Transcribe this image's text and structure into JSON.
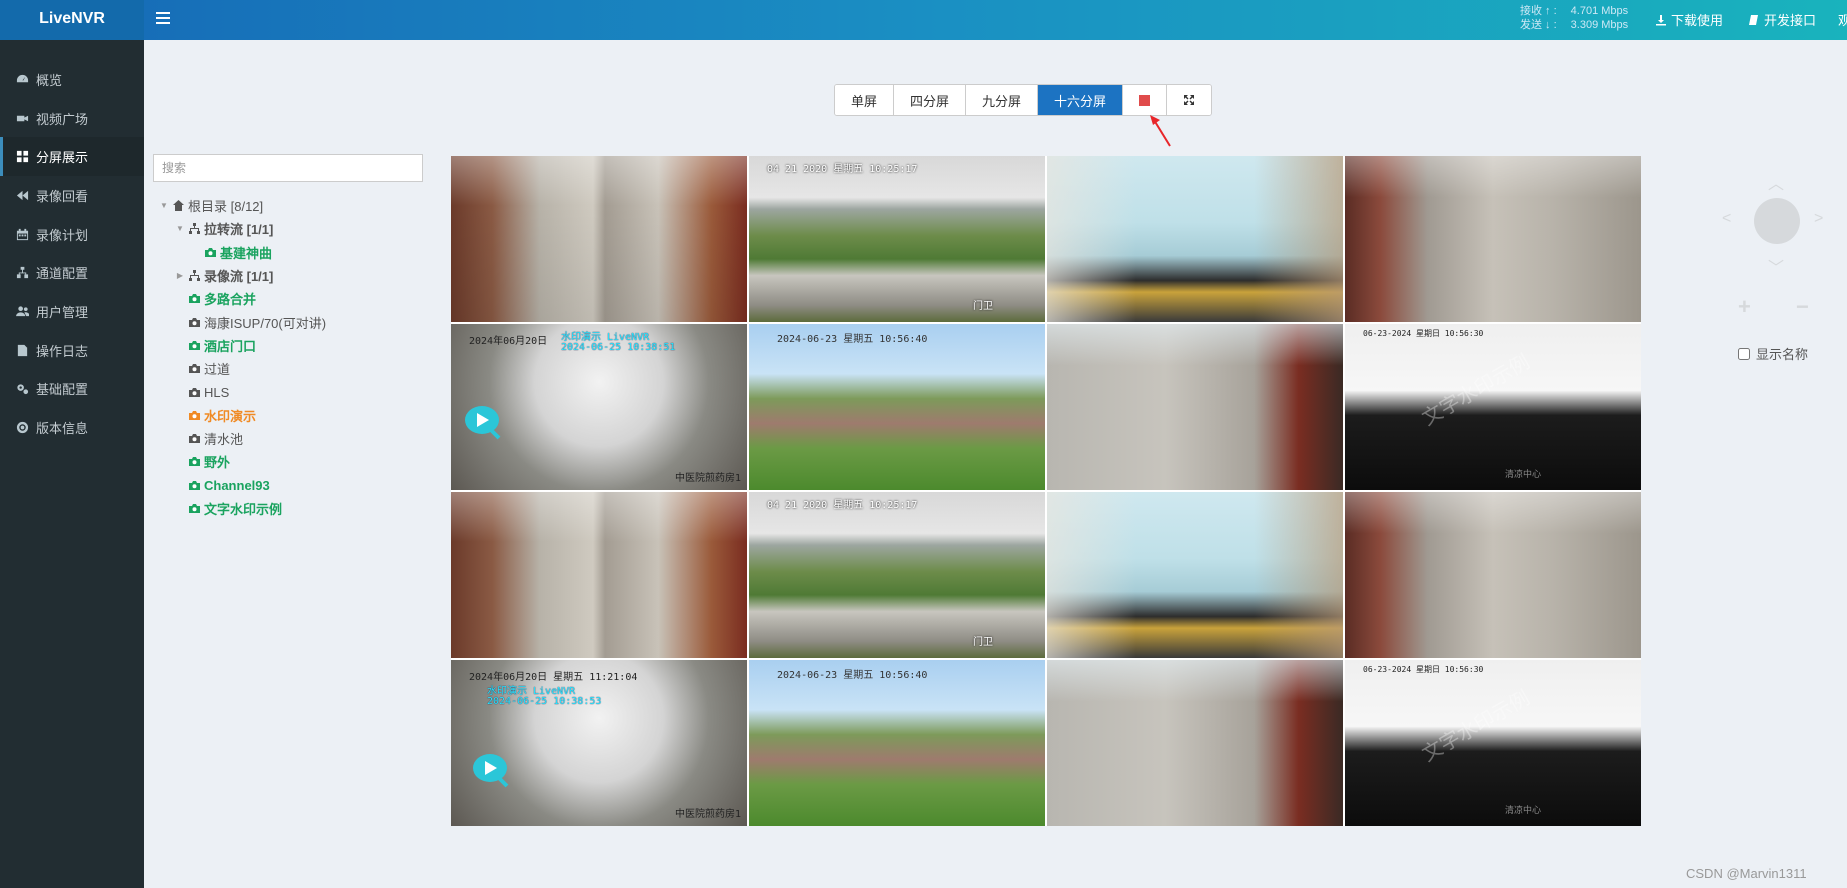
{
  "header": {
    "app_name": "LiveNVR",
    "net_rx_label": "接收 ↑ :",
    "net_rx_value": "4.701 Mbps",
    "net_tx_label": "发送 ↓ :",
    "net_tx_value": "3.309 Mbps",
    "download_label": "下载使用",
    "api_label": "开发接口",
    "edge_label": "观"
  },
  "sidebar": {
    "items": [
      {
        "label": "概览",
        "icon": "dashboard-icon"
      },
      {
        "label": "视频广场",
        "icon": "video-camera-icon"
      },
      {
        "label": "分屏展示",
        "icon": "grid-icon"
      },
      {
        "label": "录像回看",
        "icon": "rewind-icon"
      },
      {
        "label": "录像计划",
        "icon": "calendar-icon"
      },
      {
        "label": "通道配置",
        "icon": "sitemap-icon"
      },
      {
        "label": "用户管理",
        "icon": "users-icon"
      },
      {
        "label": "操作日志",
        "icon": "file-icon"
      },
      {
        "label": "基础配置",
        "icon": "cogs-icon"
      },
      {
        "label": "版本信息",
        "icon": "info-icon"
      }
    ],
    "active": "分屏展示"
  },
  "layout_buttons": {
    "single": "单屏",
    "four": "四分屏",
    "nine": "九分屏",
    "sixteen": "十六分屏",
    "active": "十六分屏"
  },
  "search": {
    "placeholder": "搜索",
    "value": ""
  },
  "tree": {
    "root": "根目录 [8/12]",
    "nodes": [
      {
        "label": "拉转流 [1/1]",
        "color": "gray"
      },
      {
        "label": "基建神曲",
        "color": "green"
      },
      {
        "label": "录像流 [1/1]",
        "color": "gray"
      },
      {
        "label": "多路合并",
        "color": "green"
      },
      {
        "label": "海康ISUP/70(可对讲)",
        "color": "gray"
      },
      {
        "label": "酒店门口",
        "color": "green"
      },
      {
        "label": "过道",
        "color": "gray"
      },
      {
        "label": "HLS",
        "color": "gray"
      },
      {
        "label": "水印演示",
        "color": "orange"
      },
      {
        "label": "清水池",
        "color": "gray"
      },
      {
        "label": "野外",
        "color": "green"
      },
      {
        "label": "Channel93",
        "color": "green"
      },
      {
        "label": "文字水印示例",
        "color": "green"
      }
    ]
  },
  "video": {
    "osd_river": "04 21 2020 星期五 10:25:17",
    "osd_river_corner": "门卫",
    "osd_office_a": "2024年06月20日",
    "osd_office_b": "2024年06月20日 星期五 11:21:04",
    "osd_office_wm1": "水印演示 LiveNVR",
    "osd_office_wm2": "2024-06-25 10:38:51",
    "osd_office_wm3": "2024-06-25 10:38:53",
    "osd_office_corner": "中医院煎药房1",
    "osd_field": "2024-06-23 星期五 10:56:40",
    "osd_white": "06-23-2024 星期日 10:56:30",
    "osd_white_wm": "文字水印示例",
    "osd_white_corner": "清凉中心"
  },
  "ptz": {
    "plus": "+",
    "minus": "−"
  },
  "show_name_label": "显示名称",
  "credit": "CSDN @Marvin1311"
}
